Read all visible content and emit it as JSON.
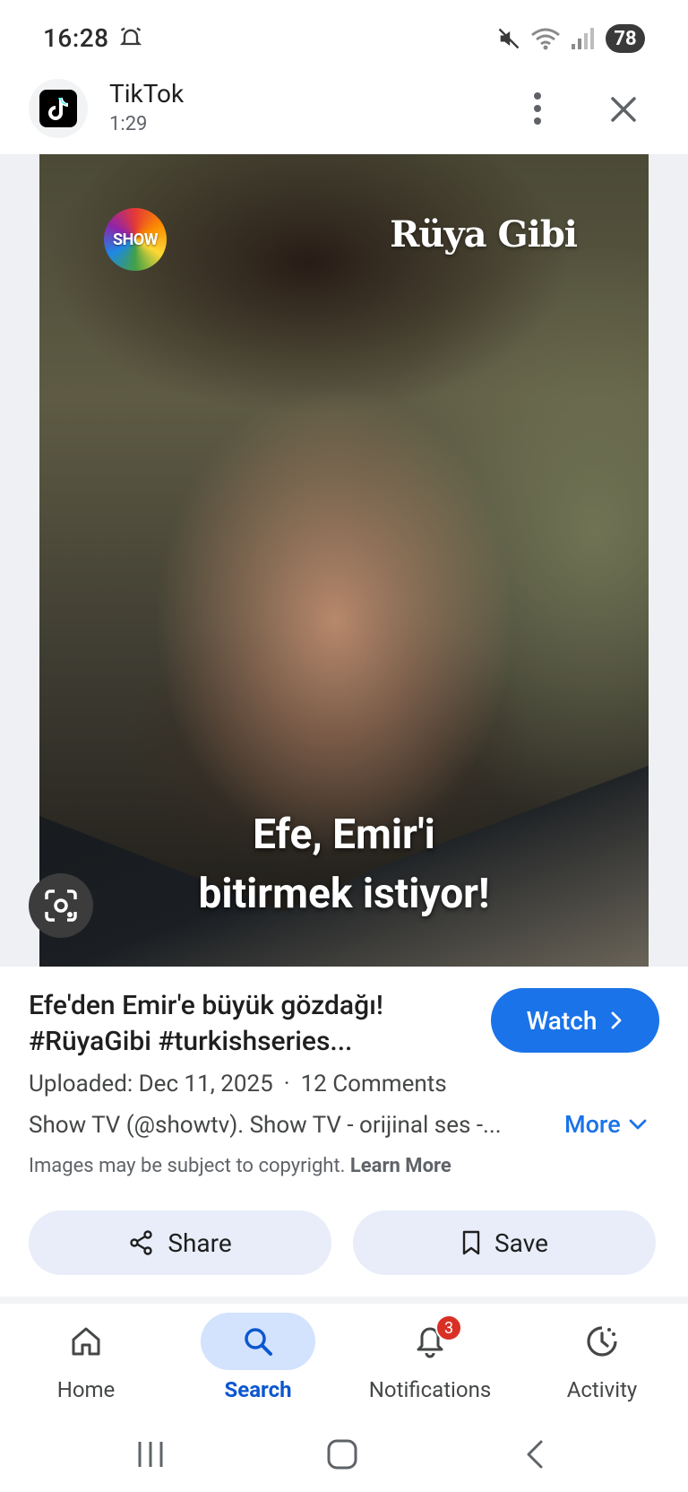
{
  "status_bar": {
    "time": "16:28",
    "battery": "78"
  },
  "app_header": {
    "app_name": "TikTok",
    "duration": "1:29"
  },
  "image": {
    "channel_logo": "SHOW",
    "show_logo": "Rüya Gibi",
    "caption_line1": "Efe, Emir'i",
    "caption_line2": "bitirmek istiyor!"
  },
  "info": {
    "title_line1": "Efe'den Emir'e büyük gözdağı!",
    "title_line2": "#RüyaGibi #turkishseries...",
    "watch_label": "Watch",
    "uploaded": "Uploaded: Dec 11, 2025",
    "separator": "·",
    "comments": "12 Comments",
    "source": "Show TV (@showtv). Show TV - orijinal ses -...",
    "more_label": "More",
    "copyright_text": "Images may be subject to copyright.",
    "learn_more": "Learn More"
  },
  "actions": {
    "share_label": "Share",
    "save_label": "Save"
  },
  "bottom_nav": {
    "items": [
      {
        "label": "Home",
        "icon": "home-icon",
        "active": false
      },
      {
        "label": "Search",
        "icon": "search-icon",
        "active": true
      },
      {
        "label": "Notifications",
        "icon": "bell-icon",
        "active": false,
        "badge": "3"
      },
      {
        "label": "Activity",
        "icon": "activity-icon",
        "active": false
      }
    ]
  },
  "colors": {
    "accent": "#1a73e8",
    "active_nav_bg": "#d3e3fd",
    "pill_bg": "#e8edf9",
    "badge": "#d93025"
  }
}
